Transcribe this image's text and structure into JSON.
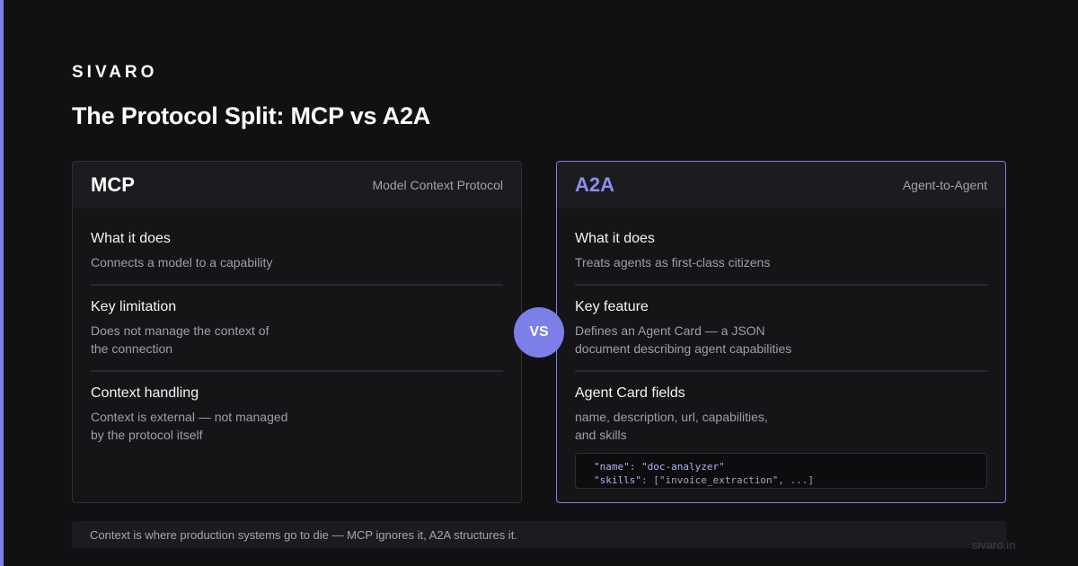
{
  "brand": "SIVARO",
  "headline": "The Protocol Split: MCP vs A2A",
  "vs_label": "VS",
  "colors": {
    "accent": "#7c7fe8",
    "background": "#111113",
    "card": "#151518"
  },
  "mcp": {
    "title": "MCP",
    "subtitle": "Model Context Protocol",
    "sections": [
      {
        "title": "What it does",
        "lines": [
          "Connects a model to a capability"
        ]
      },
      {
        "title": "Key limitation",
        "lines": [
          "Does not manage the context of",
          "the connection"
        ]
      },
      {
        "title": "Context handling",
        "lines": [
          "Context is external — not managed",
          "by the protocol itself"
        ]
      }
    ]
  },
  "a2a": {
    "title": "A2A",
    "subtitle": "Agent-to-Agent",
    "sections": [
      {
        "title": "What it does",
        "lines": [
          "Treats agents as first-class citizens"
        ]
      },
      {
        "title": "Key feature",
        "lines": [
          "Defines an Agent Card — a JSON",
          "document describing agent capabilities"
        ]
      },
      {
        "title": "Agent Card fields",
        "lines": [
          "name, description, url, capabilities,",
          "and skills"
        ]
      }
    ],
    "code": {
      "line1_key": "\"name\"",
      "line1_sep": ": ",
      "line1_value": "\"doc-analyzer\"",
      "line2_key": "\"skills\"",
      "line2_rest": ": [\"invoice_extraction\", ...]"
    }
  },
  "footer_note": "Context is where production systems go to die — MCP ignores it, A2A structures it.",
  "site": "sivaro.in"
}
